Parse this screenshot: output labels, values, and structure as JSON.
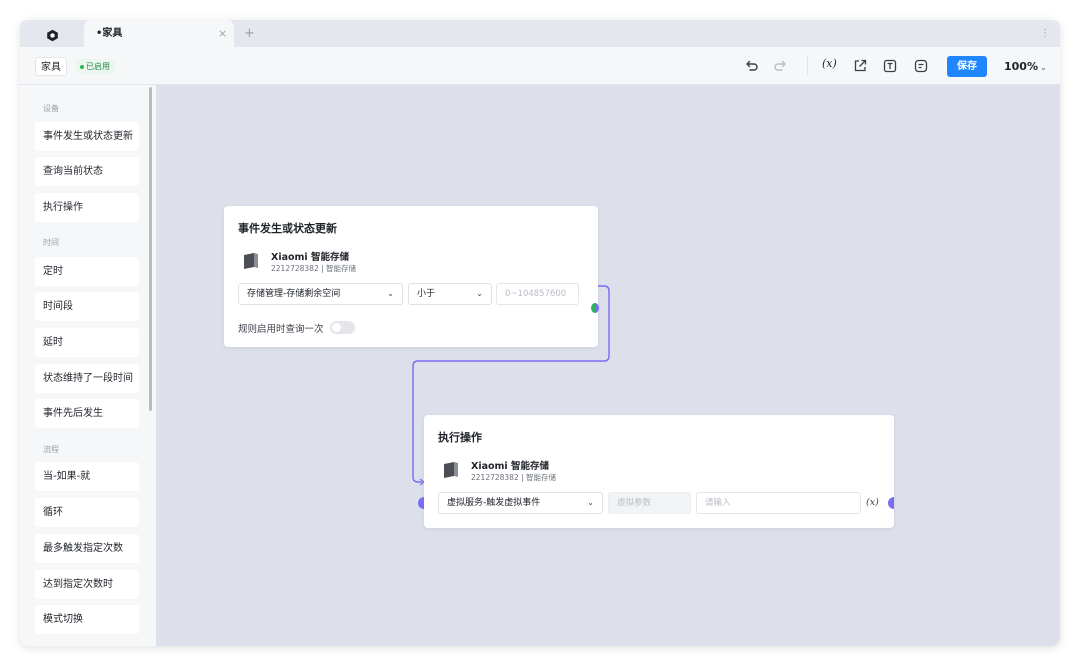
{
  "tab": {
    "title": "•家具",
    "close": "×",
    "add": "+",
    "more": "⋮"
  },
  "toolbar": {
    "name": "家具",
    "status": "已启用",
    "var_label": "(x)",
    "save_label": "保存",
    "zoom": "100%"
  },
  "sidebar": {
    "sections": [
      {
        "title": "设备",
        "items": [
          "事件发生或状态更新",
          "查询当前状态",
          "执行操作"
        ]
      },
      {
        "title": "时间",
        "items": [
          "定时",
          "时间段",
          "延时",
          "状态维持了一段时间",
          "事件先后发生"
        ]
      },
      {
        "title": "流程",
        "items": [
          "当-如果-就",
          "循环",
          "最多触发指定次数",
          "达到指定次数时",
          "模式切换"
        ]
      }
    ]
  },
  "card_event": {
    "title": "事件发生或状态更新",
    "device_name": "Xiaomi 智能存储",
    "device_sub": "2212728382 | 智能存储",
    "property": "存储管理-存储剩余空间",
    "operator": "小于",
    "value_placeholder": "0~104857600",
    "toggle_label": "规则启用时查询一次",
    "toggle_on": false
  },
  "card_action": {
    "title": "执行操作",
    "device_name": "Xiaomi 智能存储",
    "device_sub": "2212728382 | 智能存储",
    "action": "虚拟服务-触发虚拟事件",
    "param_placeholder": "虚拟参数",
    "input_placeholder": "请输入",
    "var_label": "(x)"
  },
  "colors": {
    "accent": "#1f86ff",
    "wire": "#7b6cf6",
    "port_green": "#2fb35a",
    "status_green": "#2e8b4e"
  },
  "icons": [
    "app-logo-icon",
    "undo-icon",
    "redo-icon",
    "variable-icon",
    "export-icon",
    "text-icon",
    "note-icon",
    "device-icon"
  ]
}
